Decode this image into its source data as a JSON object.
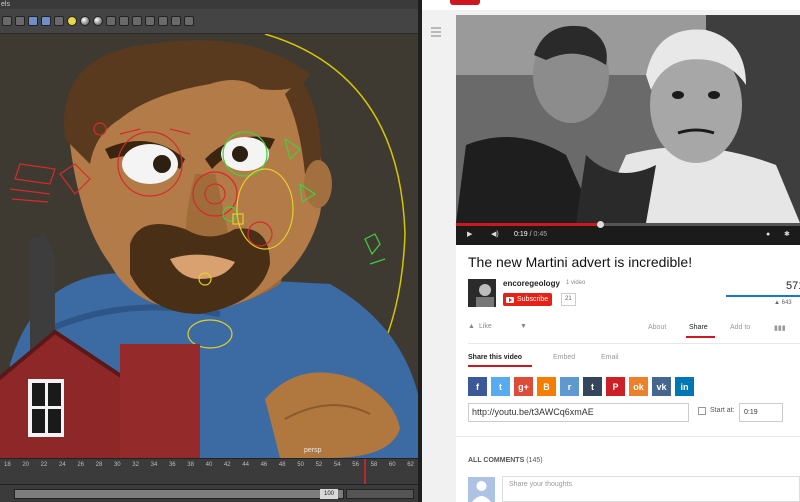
{
  "maya": {
    "menu_fragment": "els",
    "camera_label": "persp",
    "timeline_ticks": [
      "18",
      "20",
      "22",
      "24",
      "26",
      "28",
      "30",
      "32",
      "34",
      "36",
      "38",
      "40",
      "42",
      "44",
      "46",
      "48",
      "50",
      "52",
      "54",
      "56",
      "58",
      "60",
      "62"
    ],
    "range_field": "100"
  },
  "youtube": {
    "player": {
      "current_time": "0:19",
      "time_separator": "/",
      "total_time": "0:45",
      "progress_fraction": 0.42
    },
    "video_title": "The new Martini advert is incredible!",
    "channel": {
      "name": "encoregeology",
      "video_count": "1 video",
      "subscribe_label": "Subscribe",
      "subscriber_count": "21"
    },
    "view_count": "571,",
    "likes_count": "643",
    "actions": {
      "like": "Like",
      "about": "About",
      "share": "Share",
      "add_to": "Add to"
    },
    "share_tabs": {
      "share_video": "Share this video",
      "embed": "Embed",
      "email": "Email"
    },
    "social": [
      {
        "icon": "facebook-icon",
        "glyph": "f",
        "color": "#3b5998"
      },
      {
        "icon": "twitter-icon",
        "glyph": "t",
        "color": "#55acee"
      },
      {
        "icon": "google-plus-icon",
        "glyph": "g+",
        "color": "#dd4b39"
      },
      {
        "icon": "blogger-icon",
        "glyph": "B",
        "color": "#f57d00"
      },
      {
        "icon": "reddit-icon",
        "glyph": "r",
        "color": "#5f99cf"
      },
      {
        "icon": "tumblr-icon",
        "glyph": "t",
        "color": "#35465c"
      },
      {
        "icon": "pinterest-icon",
        "glyph": "P",
        "color": "#cb2027"
      },
      {
        "icon": "odnoklassniki-icon",
        "glyph": "ok",
        "color": "#ed812b"
      },
      {
        "icon": "vk-icon",
        "glyph": "vk",
        "color": "#45668e"
      },
      {
        "icon": "linkedin-icon",
        "glyph": "in",
        "color": "#0077b5"
      }
    ],
    "share_url": "http://youtu.be/t3AWCq6xmAE",
    "start_at_label": "Start at:",
    "start_at_value": "0:19",
    "comments_label": "ALL COMMENTS",
    "comments_count": "(145)",
    "comment_placeholder": "Share your thoughts"
  }
}
